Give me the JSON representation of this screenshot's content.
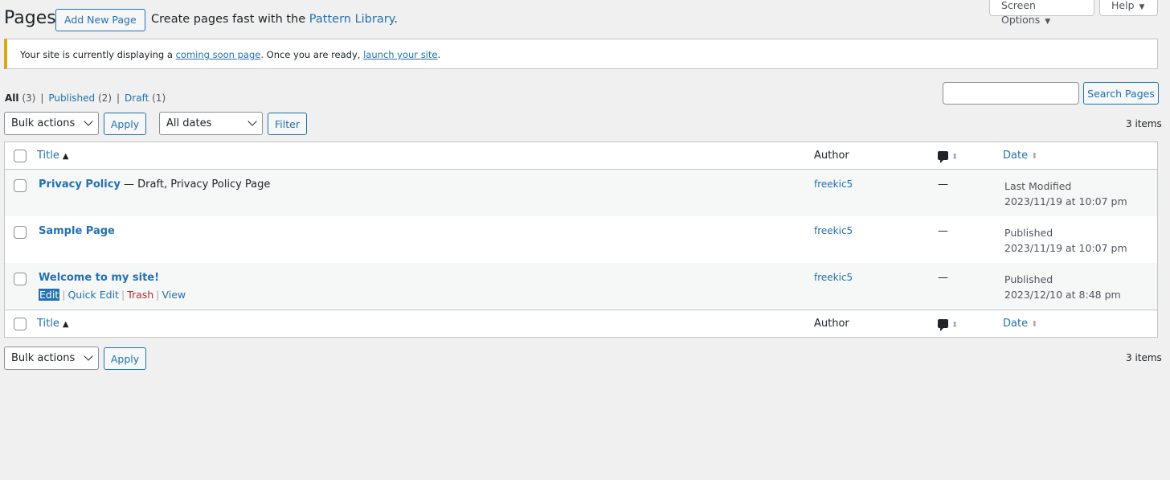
{
  "header": {
    "title": "Pages",
    "add_new": "Add New Page",
    "promo_prefix": "Create pages fast with the",
    "promo_link": "Pattern Library",
    "promo_suffix": ".",
    "screen_options": "Screen Options",
    "help": "Help"
  },
  "notice": {
    "prefix": "Your site is currently displaying a",
    "link1": "coming soon page",
    "middle": ". Once you are ready,",
    "link2": "launch your site",
    "suffix": ".",
    "accent_color": "#dba617"
  },
  "views": [
    {
      "label": "All",
      "count": "(3)"
    },
    {
      "label": "Published",
      "count": "(2)"
    },
    {
      "label": "Draft",
      "count": "(1)"
    }
  ],
  "search": {
    "button": "Search Pages",
    "value": ""
  },
  "toolbar": {
    "bulk_actions": "Bulk actions",
    "apply": "Apply",
    "dates": "All dates",
    "filter": "Filter",
    "items_count": "3 items"
  },
  "table": {
    "columns": {
      "title": "Title",
      "author": "Author",
      "date": "Date"
    },
    "rows": [
      {
        "title": "Privacy Policy",
        "state": " — Draft, Privacy Policy Page",
        "author": "freekic5",
        "comments": "—",
        "date_status": "Last Modified",
        "date": "2023/11/19 at 10:07 pm"
      },
      {
        "title": "Sample Page",
        "state": "",
        "author": "freekic5",
        "comments": "—",
        "date_status": "Published",
        "date": "2023/11/19 at 10:07 pm"
      },
      {
        "title": "Welcome to my site!",
        "state": "",
        "author": "freekic5",
        "comments": "—",
        "date_status": "Published",
        "date": "2023/12/10 at 8:48 pm"
      }
    ],
    "row_actions": {
      "edit": "Edit",
      "quick_edit": "Quick Edit",
      "trash": "Trash",
      "view": "View"
    }
  },
  "colors": {
    "link": "#2271b1",
    "background": "#f0f0f1",
    "trash": "#b32d2e"
  }
}
